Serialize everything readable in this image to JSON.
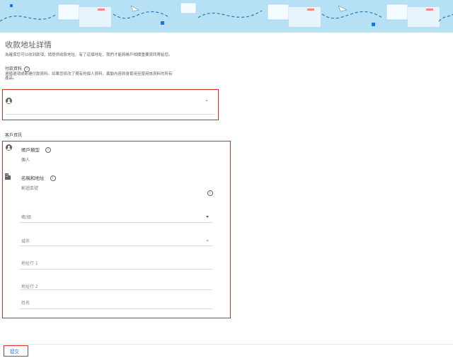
{
  "page_title": "收款地址詳情",
  "intro_text": "為確保您可以收到款項，請提供收款地址。有了這個地址，我們才能將帳戶相關重要資訊寄給您。",
  "payment_profile": {
    "label": "付款資料",
    "description_line1": "遵循選項或新建付款資料。如果您修改了現有的個人資料，異動內容將會套用至使用該資料的所有",
    "description_line2": "產品。",
    "selected_value": ""
  },
  "customer_info": {
    "section_label": "客戶資訊",
    "account_type_label": "帳戶類型",
    "account_type_value": "個人",
    "name_address_label": "名稱和地址",
    "postal_code_label": "郵遞區號",
    "county_label": "鄉/鎮",
    "city_label": "城市",
    "address_line1_label": "地址行 1",
    "address_line2_label": "地址行 2",
    "name_label": "姓名"
  },
  "submit_label": "提交",
  "colors": {
    "banner": "#b6e0f4",
    "highlight": "#d93025",
    "link": "#1a73e8"
  }
}
